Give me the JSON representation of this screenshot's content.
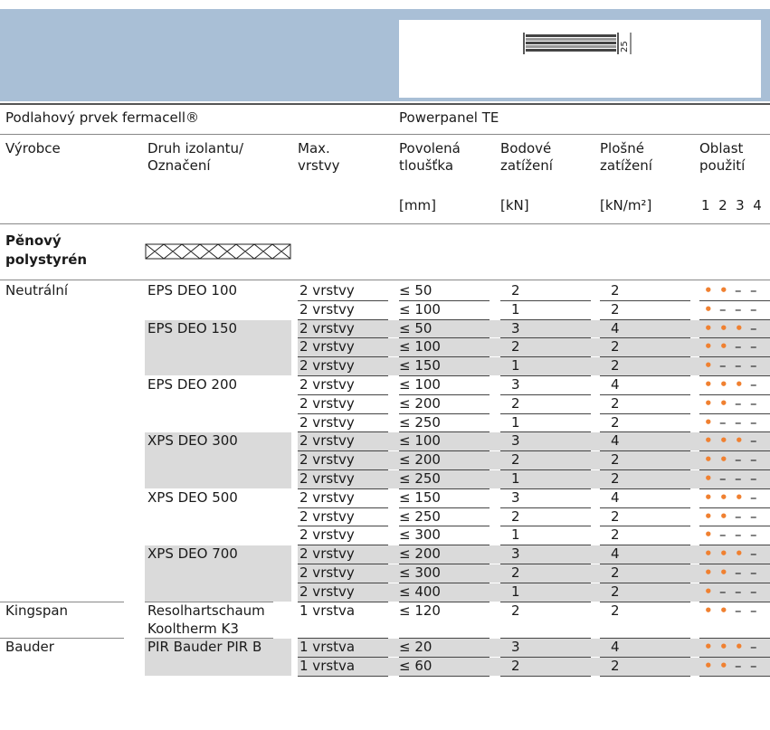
{
  "header": {
    "title_left": "Podlahový prvek fermacell®",
    "title_right": "Powerpanel TE",
    "figure_dim": "25"
  },
  "columns": {
    "manufacturer": "Výrobce",
    "type_line1": "Druh izolantu/",
    "type_line2": "Označení",
    "layers_line1": "Max.",
    "layers_line2": "vrstvy",
    "thick_line1": "Povolená",
    "thick_line2": "tloušťka",
    "point_line1": "Bodové",
    "point_line2": "zatížení",
    "area_line1": "Plošné",
    "area_line2": "zatížení",
    "use_line1": "Oblast",
    "use_line2": "použití"
  },
  "units": {
    "thick": "[mm]",
    "point": "[kN]",
    "area": "[kN/m²]",
    "use": "1  2  3  4"
  },
  "section": {
    "line1": "Pěnový",
    "line2": "polystyrén"
  },
  "rows": [
    {
      "m": "Neutrální",
      "t": "EPS DEO 100",
      "l": "2 vrstvy",
      "d": "≤ 50",
      "p": "2",
      "a": "2",
      "u": "••––"
    },
    {
      "m": "",
      "t": "",
      "l": "2 vrstvy",
      "d": "≤ 100",
      "p": "1",
      "a": "2",
      "u": "•–––"
    },
    {
      "m": "",
      "t": "EPS DEO 150",
      "l": "2 vrstvy",
      "d": "≤ 50",
      "p": "3",
      "a": "4",
      "u": "•••–"
    },
    {
      "m": "",
      "t": "",
      "l": "2 vrstvy",
      "d": "≤ 100",
      "p": "2",
      "a": "2",
      "u": "••––"
    },
    {
      "m": "",
      "t": "",
      "l": "2 vrstvy",
      "d": "≤ 150",
      "p": "1",
      "a": "2",
      "u": "•–––"
    },
    {
      "m": "",
      "t": "EPS DEO 200",
      "l": "2 vrstvy",
      "d": "≤ 100",
      "p": "3",
      "a": "4",
      "u": "•••–"
    },
    {
      "m": "",
      "t": "",
      "l": "2 vrstvy",
      "d": "≤ 200",
      "p": "2",
      "a": "2",
      "u": "••––"
    },
    {
      "m": "",
      "t": "",
      "l": "2 vrstvy",
      "d": "≤ 250",
      "p": "1",
      "a": "2",
      "u": "•–––"
    },
    {
      "m": "",
      "t": "XPS DEO 300",
      "l": "2 vrstvy",
      "d": "≤ 100",
      "p": "3",
      "a": "4",
      "u": "•••–"
    },
    {
      "m": "",
      "t": "",
      "l": "2 vrstvy",
      "d": "≤ 200",
      "p": "2",
      "a": "2",
      "u": "••––"
    },
    {
      "m": "",
      "t": "",
      "l": "2 vrstvy",
      "d": "≤ 250",
      "p": "1",
      "a": "2",
      "u": "•–––"
    },
    {
      "m": "",
      "t": "XPS DEO 500",
      "l": "2 vrstvy",
      "d": "≤ 150",
      "p": "3",
      "a": "4",
      "u": "•••–"
    },
    {
      "m": "",
      "t": "",
      "l": "2 vrstvy",
      "d": "≤ 250",
      "p": "2",
      "a": "2",
      "u": "••––"
    },
    {
      "m": "",
      "t": "",
      "l": "2 vrstvy",
      "d": "≤ 300",
      "p": "1",
      "a": "2",
      "u": "•–––"
    },
    {
      "m": "",
      "t": "XPS DEO 700",
      "l": "2 vrstvy",
      "d": "≤ 200",
      "p": "3",
      "a": "4",
      "u": "•••–"
    },
    {
      "m": "",
      "t": "",
      "l": "2 vrstvy",
      "d": "≤ 300",
      "p": "2",
      "a": "2",
      "u": "••––"
    },
    {
      "m": "",
      "t": "",
      "l": "2 vrstvy",
      "d": "≤ 400",
      "p": "1",
      "a": "2",
      "u": "•–––"
    },
    {
      "m": "Kingspan",
      "t": "Resolhartschaum",
      "t2": "Kooltherm K3",
      "l": "1 vrstva",
      "d": "≤ 120",
      "p": "2",
      "a": "2",
      "u": "••––"
    },
    {
      "m": "Bauder",
      "t": "PIR Bauder PIR B",
      "l": "1 vrstva",
      "d": "≤ 20",
      "p": "3",
      "a": "4",
      "u": "•••–"
    },
    {
      "m": "",
      "t": "",
      "l": "1 vrstva",
      "d": "≤ 60",
      "p": "2",
      "a": "2",
      "u": "••––"
    }
  ],
  "colors": {
    "banner": "#a9bfd6",
    "dot": "#f08030",
    "shade": "#dadada"
  }
}
